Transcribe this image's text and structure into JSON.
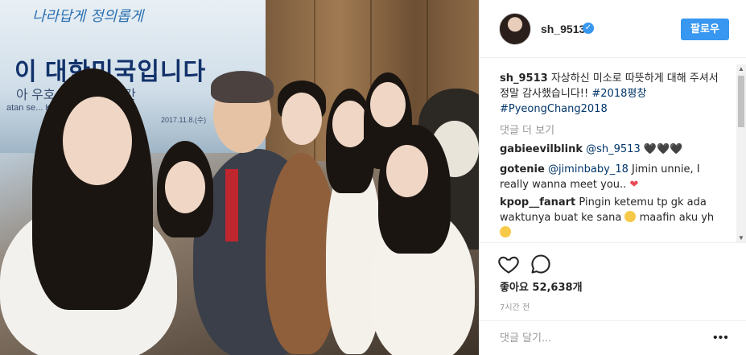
{
  "photo": {
    "banner_script": "나라답게 정의롭게",
    "banner_main": "이 대한민국입니다",
    "banner_sub": "아 우호 ... 위한 동포간",
    "banner_latin": "atan se...    Korea dan In...",
    "banner_date": "2017.11.8.(수)"
  },
  "post_header": {
    "username": "sh_9513",
    "verified_icon": "verified-badge-icon",
    "follow_label": "팔로우"
  },
  "caption": {
    "username": "sh_9513",
    "text": "자상하신 미소로 따뜻하게 대해 주셔서 정말 감사했습니다!!",
    "hashtag1": "#2018평창",
    "hashtag2": "#PyeongChang2018"
  },
  "more_comments_label": "댓글 더 보기",
  "comments": [
    {
      "user": "gabieevilblink",
      "mention": "@sh_9513",
      "text": "🖤🖤🖤"
    },
    {
      "user": "gotenie",
      "mention": "@jiminbaby_18",
      "text": "Jimin unnie, I really wanna meet you..",
      "emoji": "❤"
    },
    {
      "user": "kpop__fanart",
      "text": "Pingin ketemu tp gk ada waktunya buat ke sana",
      "text2": "maafin aku yh"
    }
  ],
  "likes_label": "좋아요 52,638개",
  "timestamp": "7시간 전",
  "add_comment_placeholder": "댓글 달기...",
  "options_icon": "•••",
  "colors": {
    "accent": "#3897f0",
    "heart": "#ed4956",
    "link": "#003569",
    "muted": "#999999"
  }
}
